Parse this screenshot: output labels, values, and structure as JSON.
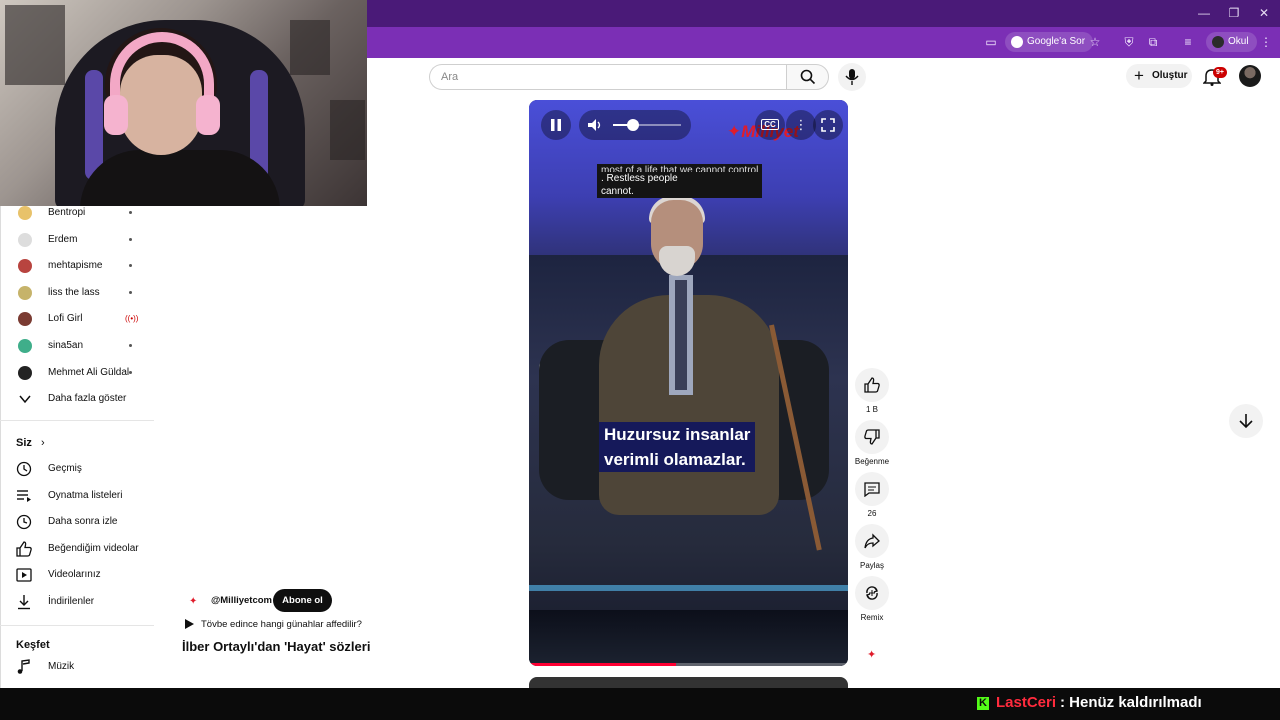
{
  "browser": {
    "toolbar": {
      "google_sor": "Google'a Sor",
      "profile": "Okul"
    }
  },
  "header": {
    "search_placeholder": "Ara",
    "create_label": "Oluştur",
    "notification_count": "9+"
  },
  "sidebar": {
    "subscriptions": [
      {
        "label": "Bentropi",
        "avatar_color": "#e8c26a",
        "indicator": "dot"
      },
      {
        "label": "Erdem",
        "avatar_color": "#dddddd",
        "indicator": "dot"
      },
      {
        "label": "mehtapisme",
        "avatar_color": "#b8443f",
        "indicator": "dot"
      },
      {
        "label": "liss the lass",
        "avatar_color": "#c6b36a",
        "indicator": "dot"
      },
      {
        "label": "Lofi Girl",
        "avatar_color": "#7a3b32",
        "indicator": "live"
      },
      {
        "label": "sina5an",
        "avatar_color": "#3fae8a",
        "indicator": "dot"
      },
      {
        "label": "Mehmet Ali Güldal",
        "avatar_color": "#222222",
        "indicator": "dot"
      }
    ],
    "show_more": "Daha fazla göster",
    "you_section": {
      "title": "Siz",
      "items": [
        {
          "label": "Geçmiş",
          "icon": "history-icon"
        },
        {
          "label": "Oynatma listeleri",
          "icon": "playlist-icon"
        },
        {
          "label": "Daha sonra izle",
          "icon": "clock-icon"
        },
        {
          "label": "Beğendiğim videolar",
          "icon": "thumbs-up-icon"
        },
        {
          "label": "Videolarınız",
          "icon": "video-icon"
        },
        {
          "label": "İndirilenler",
          "icon": "download-icon"
        }
      ]
    },
    "explore_section": {
      "title": "Keşfet",
      "items": [
        {
          "label": "Müzik",
          "icon": "music-icon"
        }
      ]
    }
  },
  "player": {
    "watermark": "Milliyet",
    "caption_top": {
      "line1": "most of a life that we cannot control",
      "line2": ". Restless people",
      "line3": "cannot."
    },
    "caption_main": {
      "line1": "Huzursuz insanlar",
      "line2": "verimli olamazlar."
    },
    "volume_level": 0.3,
    "progress": 0.46
  },
  "actions": {
    "like_count": "1 B",
    "dislike_label": "Beğenme",
    "comment_count": "26",
    "share_label": "Paylaş",
    "remix_label": "Remix"
  },
  "video": {
    "channel": "@Milliyetcom",
    "subscribe_label": "Abone ol",
    "related": "Tövbe edince hangi günahlar affedilir?",
    "title": "İlber Ortaylı'dan 'Hayat' sözleri"
  },
  "stream_overlay": {
    "kick_icon": "K",
    "username": "LastCeri",
    "status": ": Henüz kaldırılmadı"
  },
  "colors": {
    "browser_tab": "#4a1a78",
    "browser_toolbar": "#7b2fb5",
    "accent_red": "#ff0033",
    "kick_green": "#53fc18"
  }
}
